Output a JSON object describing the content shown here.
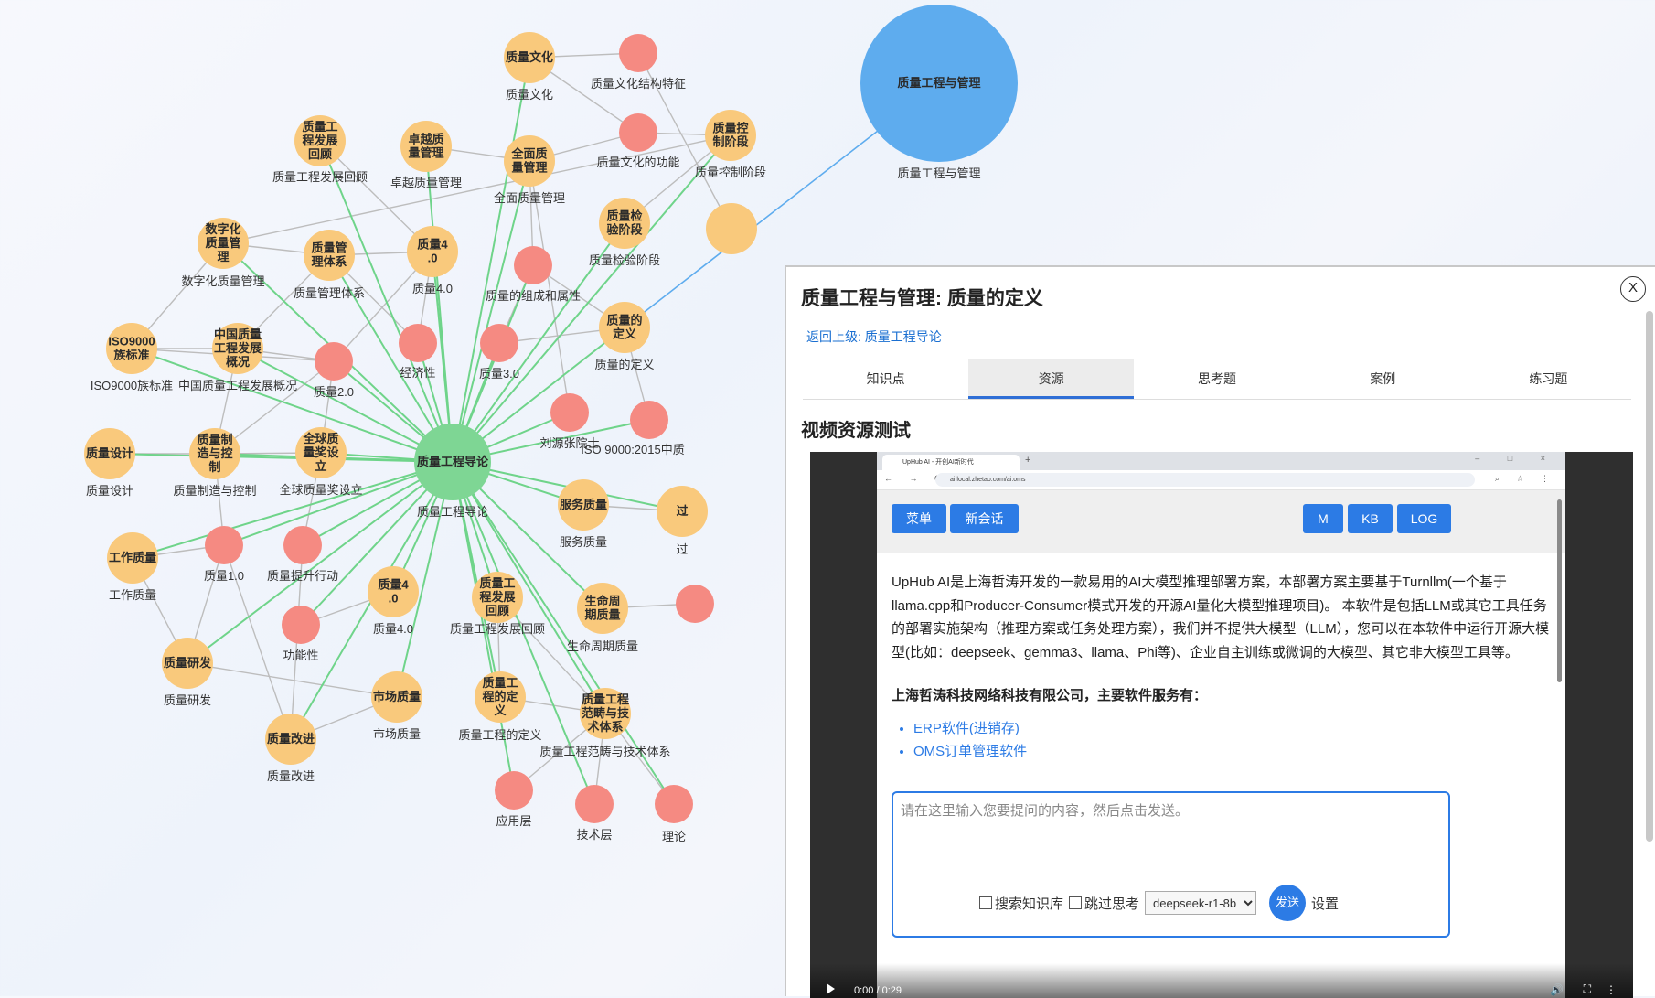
{
  "graph": {
    "nodes": [
      {
        "id": "center",
        "label": "质量工程导论",
        "sub": "质量工程导论",
        "type": "green"
      },
      {
        "id": "root",
        "label": "质量工程与管理",
        "sub": "质量工程与管理",
        "type": "blue"
      },
      {
        "id": "n1",
        "label": "质量文化",
        "sub": "质量文化",
        "type": "orange"
      },
      {
        "id": "n2",
        "label": "",
        "sub": "质量文化结构特征",
        "type": "red"
      },
      {
        "id": "n3",
        "label": "",
        "sub": "质量文化的功能",
        "type": "red"
      },
      {
        "id": "n4",
        "label": "质量控制阶段",
        "sub": "质量控制阶段",
        "type": "orange"
      },
      {
        "id": "n5",
        "label": "质量工程发展回顾",
        "sub": "质量工程发展回顾",
        "type": "orange"
      },
      {
        "id": "n6",
        "label": "卓越质量管理",
        "sub": "卓越质量管理",
        "type": "orange"
      },
      {
        "id": "n7",
        "label": "全面质量管理",
        "sub": "全面质量管理",
        "type": "orange"
      },
      {
        "id": "n8",
        "label": "质量检验阶段",
        "sub": "质量检验阶段",
        "type": "orange"
      },
      {
        "id": "n9",
        "label": "数字化质量管理",
        "sub": "数字化质量管理",
        "type": "orange"
      },
      {
        "id": "n10",
        "label": "质量管理体系",
        "sub": "质量管理体系",
        "type": "orange"
      },
      {
        "id": "n11",
        "label": "质量4.0",
        "sub": "质量4.0",
        "type": "orange"
      },
      {
        "id": "n12",
        "label": "",
        "sub": "质量的组成和属性",
        "type": "red"
      },
      {
        "id": "n13",
        "label": "ISO9000族标准",
        "sub": "ISO9000族标准",
        "type": "orange"
      },
      {
        "id": "n14",
        "label": "中国质量工程发展概况",
        "sub": "中国质量工程发展概况",
        "type": "orange"
      },
      {
        "id": "n15",
        "label": "",
        "sub": "质量2.0",
        "type": "red"
      },
      {
        "id": "n16",
        "label": "",
        "sub": "经济性",
        "type": "red"
      },
      {
        "id": "n17",
        "label": "",
        "sub": "质量3.0",
        "type": "red"
      },
      {
        "id": "n18",
        "label": "质量的定义",
        "sub": "质量的定义",
        "type": "orange"
      },
      {
        "id": "n19",
        "label": "",
        "sub": "刘源张院士",
        "type": "red"
      },
      {
        "id": "n20",
        "label": "",
        "sub": "ISO 9000:2015中质",
        "type": "red"
      },
      {
        "id": "n21",
        "label": "质量设计",
        "sub": "质量设计",
        "type": "orange"
      },
      {
        "id": "n22",
        "label": "质量制造与控制",
        "sub": "质量制造与控制",
        "type": "orange"
      },
      {
        "id": "n23",
        "label": "全球质量奖设立",
        "sub": "全球质量奖设立",
        "type": "orange"
      },
      {
        "id": "n24",
        "label": "服务质量",
        "sub": "服务质量",
        "type": "orange"
      },
      {
        "id": "n25",
        "label": "过",
        "sub": "过",
        "type": "orange"
      },
      {
        "id": "n26",
        "label": "工作质量",
        "sub": "工作质量",
        "type": "orange"
      },
      {
        "id": "n27",
        "label": "",
        "sub": "质量1.0",
        "type": "red"
      },
      {
        "id": "n28",
        "label": "",
        "sub": "质量提升行动",
        "type": "red"
      },
      {
        "id": "n29",
        "label": "质量4.0",
        "sub": "质量4.0",
        "type": "orange"
      },
      {
        "id": "n30",
        "label": "质量工程发展回顾",
        "sub": "质量工程发展回顾",
        "type": "orange"
      },
      {
        "id": "n31",
        "label": "生命周期质量",
        "sub": "生命周期质量",
        "type": "orange"
      },
      {
        "id": "n32",
        "label": "质量研发",
        "sub": "质量研发",
        "type": "orange"
      },
      {
        "id": "n33",
        "label": "",
        "sub": "功能性",
        "type": "red"
      },
      {
        "id": "n34",
        "label": "市场质量",
        "sub": "市场质量",
        "type": "orange"
      },
      {
        "id": "n35",
        "label": "质量工程的定义",
        "sub": "质量工程的定义",
        "type": "orange"
      },
      {
        "id": "n36",
        "label": "质量工程范畴与技术体系",
        "sub": "质量工程范畴与技术体系",
        "type": "orange"
      },
      {
        "id": "n37",
        "label": "质量改进",
        "sub": "质量改进",
        "type": "orange"
      },
      {
        "id": "n38",
        "label": "",
        "sub": "应用层",
        "type": "red"
      },
      {
        "id": "n39",
        "label": "",
        "sub": "技术层",
        "type": "red"
      },
      {
        "id": "n40",
        "label": "",
        "sub": "理论",
        "type": "red"
      },
      {
        "id": "n41",
        "label": "",
        "sub": "",
        "type": "orange"
      },
      {
        "id": "n42",
        "label": "",
        "sub": "",
        "type": "red"
      }
    ],
    "colors": {
      "green": "#7ed694",
      "orange": "#f9c97c",
      "red": "#f58a82",
      "blue": "#5eacee",
      "edge_green": "#6fd48a",
      "edge_gray": "#bdbdbd",
      "edge_blue": "#5eacee"
    }
  },
  "panel": {
    "title": "质量工程与管理: 质量的定义",
    "back_link": "返回上级:  质量工程导论",
    "close_label": "X",
    "tabs": [
      "知识点",
      "资源",
      "思考题",
      "案例",
      "练习题"
    ],
    "active_tab": "资源",
    "section_title": "视频资源测试"
  },
  "video": {
    "browser_tab_title": "UpHub AI - 开创AI新时代",
    "tab_plus": "+",
    "window_controls": "– □ ×",
    "nav_icons": "← → C",
    "url": "ai.local.zhetao.com/ai.oms",
    "addr_right_icons": "⌕ ☆ ⋮",
    "app_buttons": {
      "menu": "菜单",
      "new_chat": "新会话",
      "m": "M",
      "kb": "KB",
      "log": "LOG"
    },
    "intro": "UpHub AI是上海哲涛开发的一款易用的AI大模型推理部署方案，本部署方案主要基于Turnllm(一个基于llama.cpp和Producer-Consumer模式开发的开源AI量化大模型推理项目)。 本软件是包括LLM或其它工具任务的部署实施架构（推理方案或任务处理方案），我们并不提供大模型（LLM），您可以在本软件中运行开源大模型(比如：deepseek、gemma3、llama、Phi等)、企业自主训练或微调的大模型、其它非大模型工具等。",
    "company": "上海哲涛科技网络科技有限公司，主要软件服务有：",
    "services": [
      "ERP软件(进销存)",
      "OMS订单管理软件"
    ],
    "input_placeholder": "请在这里输入您要提问的内容，然后点击发送。",
    "search_kb": "搜索知识库",
    "skip_think": "跳过思考",
    "model": "deepseek-r1-8b",
    "send": "发送",
    "settings": "设置",
    "time": "0:00 / 0:29"
  }
}
